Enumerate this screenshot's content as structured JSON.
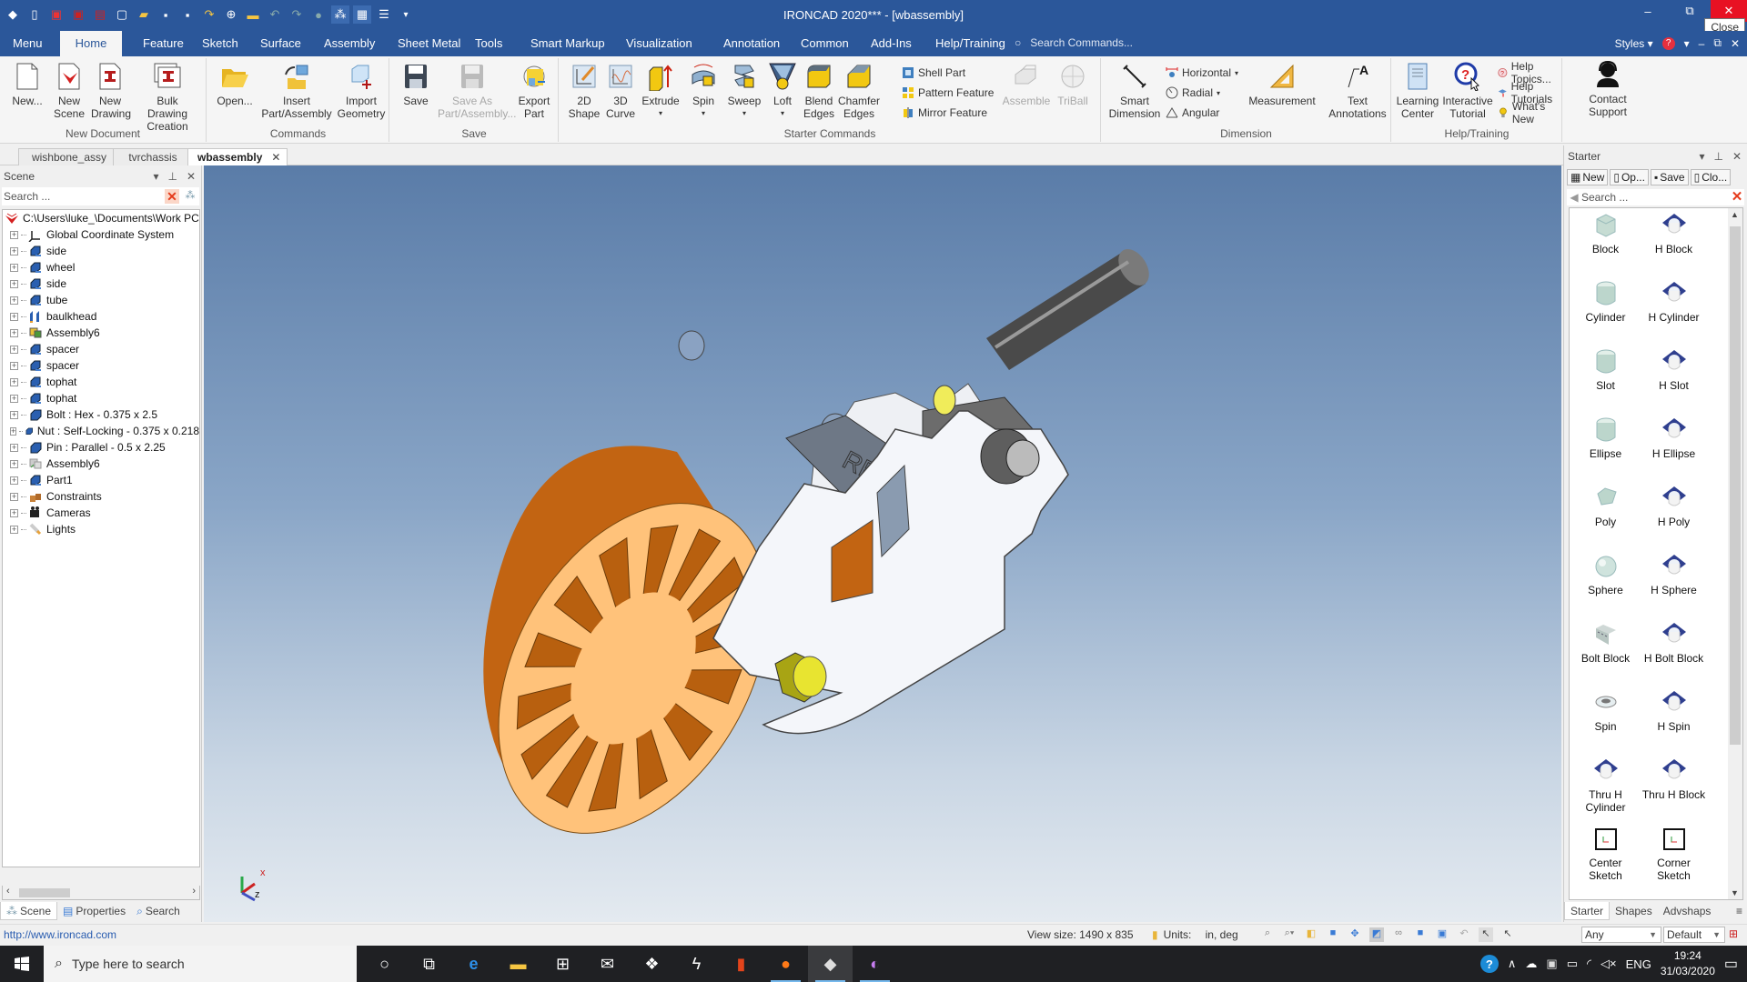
{
  "window": {
    "title": "IRONCAD 2020*** - [wbassembly]",
    "controls": {
      "minimize": "–",
      "restore": "⧉",
      "close": "✕"
    },
    "tooltip": "Close"
  },
  "quick_access": [
    "app-logo",
    "new-icon",
    "new-scene-icon",
    "new-drawing-icon",
    "bulk-drawing-icon",
    "new-template-icon",
    "open-icon",
    "save-icon",
    "save-as-icon",
    "insert-icon",
    "import-icon",
    "catalog-icon",
    "undo-icon",
    "redo-icon",
    "render-icon",
    "triball-icon",
    "panel-icon",
    "list-icon",
    "customize-icon"
  ],
  "menu": {
    "tabs": [
      "Menu",
      "Home",
      "Feature",
      "Sketch",
      "Surface",
      "Assembly",
      "Sheet Metal",
      "Tools",
      "Smart Markup",
      "Visualization",
      "Annotation",
      "Common",
      "Add-Ins",
      "Help/Training"
    ],
    "active": "Home",
    "search_placeholder": "Search Commands...",
    "styles_label": "Styles",
    "help": "?"
  },
  "ribbon": {
    "groups": {
      "new_document": {
        "label": "New Document",
        "buttons": [
          "New...",
          "New Scene",
          "New Drawing",
          "Bulk Drawing Creation"
        ]
      },
      "commands": {
        "label": "Commands",
        "buttons": [
          "Open...",
          "Insert Part/Assembly",
          "Import Geometry"
        ]
      },
      "save": {
        "label": "Save",
        "buttons": [
          "Save",
          "Save As Part/Assembly...",
          "Export Part"
        ]
      },
      "starter": {
        "label": "Starter Commands",
        "buttons": [
          "2D Shape",
          "3D Curve",
          "Extrude",
          "Spin",
          "Sweep",
          "Loft",
          "Blend Edges",
          "Chamfer Edges"
        ],
        "small": [
          "Shell Part",
          "Pattern Feature",
          "Mirror Feature"
        ],
        "disabled": [
          "Assemble",
          "TriBall"
        ]
      },
      "dimension": {
        "label": "Dimension",
        "buttons": [
          "Smart Dimension",
          "Measurement",
          "Text Annotations"
        ],
        "small": [
          "Horizontal",
          "Radial",
          "Angular"
        ]
      },
      "help": {
        "label": "Help/Training",
        "buttons": [
          "Learning Center",
          "Interactive Tutorial",
          "Contact Support"
        ],
        "small": [
          "Help Topics...",
          "Help Tutorials",
          "What's New"
        ]
      }
    }
  },
  "doc_tabs": [
    {
      "label": "wishbone_assy",
      "active": false
    },
    {
      "label": "tvrchassis",
      "active": false
    },
    {
      "label": "wbassembly",
      "active": true
    }
  ],
  "scene_panel": {
    "title": "Scene",
    "search_placeholder": "Search ...",
    "root": "C:\\Users\\luke_\\Documents\\Work PC",
    "items": [
      {
        "label": "Global Coordinate System",
        "icon": "coordinate-system-icon"
      },
      {
        "label": "side",
        "icon": "part-link-icon"
      },
      {
        "label": "wheel",
        "icon": "part-link-icon"
      },
      {
        "label": "side",
        "icon": "part-link-icon"
      },
      {
        "label": "tube",
        "icon": "part-link-icon"
      },
      {
        "label": "baulkhead",
        "icon": "sheet-part-icon"
      },
      {
        "label": "Assembly6",
        "icon": "assembly-icon"
      },
      {
        "label": "spacer",
        "icon": "part-link-icon"
      },
      {
        "label": "spacer",
        "icon": "part-link-icon"
      },
      {
        "label": "tophat",
        "icon": "part-link-icon"
      },
      {
        "label": "tophat",
        "icon": "part-link-icon"
      },
      {
        "label": "Bolt : Hex - 0.375 x 2.5",
        "icon": "part-icon"
      },
      {
        "label": "Nut : Self-Locking - 0.375 x 0.218",
        "icon": "part-icon"
      },
      {
        "label": "Pin : Parallel - 0.5 x 2.25",
        "icon": "part-icon"
      },
      {
        "label": "Assembly6",
        "icon": "assembly-grey-icon"
      },
      {
        "label": "Part1",
        "icon": "part-link-icon"
      },
      {
        "label": "Constraints",
        "icon": "constraints-icon"
      },
      {
        "label": "Cameras",
        "icon": "camera-icon"
      },
      {
        "label": "Lights",
        "icon": "light-icon"
      }
    ],
    "tabs": [
      "Scene",
      "Properties",
      "Search"
    ],
    "active_tab": "Scene"
  },
  "viewport": {
    "triad_labels": {
      "x": "x",
      "z": "z"
    },
    "embossed_text": "RRC"
  },
  "catalog_panel": {
    "title": "Starter",
    "buttons": [
      "New",
      "Op...",
      "Save",
      "Clo..."
    ],
    "search_placeholder": "Search ...",
    "items": [
      {
        "label": "Block",
        "kind": "solid"
      },
      {
        "label": "H Block",
        "kind": "hole"
      },
      {
        "label": "Cylinder",
        "kind": "solid"
      },
      {
        "label": "H Cylinder",
        "kind": "hole"
      },
      {
        "label": "Slot",
        "kind": "solid"
      },
      {
        "label": "H Slot",
        "kind": "hole"
      },
      {
        "label": "Ellipse",
        "kind": "solid"
      },
      {
        "label": "H Ellipse",
        "kind": "hole"
      },
      {
        "label": "Poly",
        "kind": "solid"
      },
      {
        "label": "H Poly",
        "kind": "hole"
      },
      {
        "label": "Sphere",
        "kind": "solid"
      },
      {
        "label": "H Sphere",
        "kind": "hole"
      },
      {
        "label": "Bolt Block",
        "kind": "solid"
      },
      {
        "label": "H Bolt Block",
        "kind": "hole"
      },
      {
        "label": "Spin",
        "kind": "solid"
      },
      {
        "label": "H Spin",
        "kind": "hole"
      },
      {
        "label": "Thru H Cylinder",
        "kind": "hole"
      },
      {
        "label": "Thru H Block",
        "kind": "hole"
      },
      {
        "label": "Center Sketch",
        "kind": "sketch"
      },
      {
        "label": "Corner Sketch",
        "kind": "sketch"
      }
    ],
    "tabs": [
      "Starter",
      "Shapes",
      "Advshaps"
    ],
    "active_tab": "Starter"
  },
  "status_bar": {
    "url": "http://www.ironcad.com",
    "view_size": "View size: 1490 x  835",
    "units_label": "Units:",
    "units_value": "in, deg",
    "filter": "Any",
    "style": "Default"
  },
  "taskbar": {
    "search_placeholder": "Type here to search",
    "apps": [
      "cortana",
      "task-view",
      "edge",
      "file-explorer",
      "store",
      "mail",
      "dropbox",
      "vpn",
      "office",
      "firefox",
      "ironcad",
      "paint3d"
    ],
    "language": "ENG",
    "time": "19:24",
    "date": "31/03/2020"
  },
  "colors": {
    "brand": "#2b579a",
    "close": "#e81123",
    "wheel": "#c7640f",
    "wheel_face": "#ffc27a",
    "bracket": "#f2f4f8",
    "bolt": "#e6dc3a"
  }
}
